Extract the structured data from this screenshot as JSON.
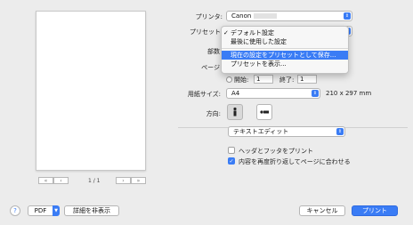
{
  "printer": {
    "label": "プリンタ:",
    "value": "Canon"
  },
  "presets": {
    "label": "プリセット",
    "menu": {
      "items": [
        {
          "label": "デフォルト設定",
          "checked": true
        },
        {
          "label": "最後に使用した設定",
          "checked": false
        }
      ],
      "actions": [
        {
          "label": "現在の設定をプリセットとして保存...",
          "highlighted": true
        },
        {
          "label": "プリセットを表示...",
          "highlighted": false
        }
      ]
    }
  },
  "copies": {
    "label_partial": "部数"
  },
  "pages": {
    "label_partial": "ページ",
    "from_label": "開始:",
    "from_value": "1",
    "to_label": "終了:",
    "to_value": "1"
  },
  "paper_size": {
    "label": "用紙サイズ:",
    "value": "A4",
    "dimensions": "210 x 297 mm"
  },
  "orientation": {
    "label": "方向:",
    "selected": "portrait"
  },
  "app_section": {
    "value": "テキストエディット"
  },
  "options": [
    {
      "label": "ヘッダとフッタをプリント",
      "checked": false
    },
    {
      "label": "内容を再度折り返してページに合わせる",
      "checked": true
    }
  ],
  "preview": {
    "page_count": "1 / 1",
    "nav": [
      "«",
      "‹",
      "›",
      "»"
    ]
  },
  "bottom": {
    "help": "?",
    "pdf": "PDF",
    "details_toggle": "詳細を非表示",
    "cancel": "キャンセル",
    "print": "プリント"
  },
  "colors": {
    "accent": "#3a7cf5",
    "background": "#ececec"
  }
}
